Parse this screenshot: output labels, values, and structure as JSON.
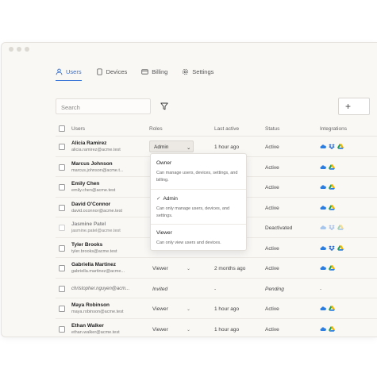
{
  "tabs": [
    {
      "label": "Users",
      "icon": "user-icon",
      "active": true
    },
    {
      "label": "Devices",
      "icon": "device-icon",
      "active": false
    },
    {
      "label": "Billing",
      "icon": "card-icon",
      "active": false
    },
    {
      "label": "Settings",
      "icon": "gear-icon",
      "active": false
    }
  ],
  "search": {
    "placeholder": "Search"
  },
  "add_button": {
    "label": "+"
  },
  "columns": {
    "users": "Users",
    "roles": "Roles",
    "last_active": "Last active",
    "status": "Status",
    "integrations": "Integrations"
  },
  "rows": [
    {
      "name": "Alicia Ramirez",
      "email": "alicia.ramirez@acme.test",
      "role": "Admin",
      "last_active": "1 hour ago",
      "status": "Active"
    },
    {
      "name": "Marcus Johnson",
      "email": "marcus.johnson@acme.t...",
      "role": "",
      "last_active": "",
      "status": "Active"
    },
    {
      "name": "Emily Chen",
      "email": "emily.chen@acme.test",
      "role": "",
      "last_active": "",
      "status": "Active"
    },
    {
      "name": "David O'Connor",
      "email": "david.oconnor@acme.test",
      "role": "",
      "last_active": "",
      "status": "Active"
    },
    {
      "name": "Jasmine Patel",
      "email": "jasmine.patel@acme.test",
      "role": "",
      "last_active": "",
      "status": "Deactivated"
    },
    {
      "name": "Tyler Brooks",
      "email": "tyler.brooks@acme.test",
      "role": "",
      "last_active": "",
      "status": "Active"
    },
    {
      "name": "Gabriella Martinez",
      "email": "gabriella.martinez@acme...",
      "role": "Viewer",
      "last_active": "2 months ago",
      "status": "Active"
    },
    {
      "name": "",
      "email": "christopher.nguyen@acm...",
      "role": "Invited",
      "last_active": "-",
      "status": "Pending",
      "integrations": "-"
    },
    {
      "name": "Maya Robinson",
      "email": "maya.robinson@acme.test",
      "role": "Viewer",
      "last_active": "1 hour ago",
      "status": "Active"
    },
    {
      "name": "Ethan Walker",
      "email": "ethan.walker@acme.test",
      "role": "Viewer",
      "last_active": "1 hour ago",
      "status": "Active"
    }
  ],
  "role_dropdown": {
    "options": [
      {
        "title": "Owner",
        "desc": "Can manage users, devices, settings, and billing."
      },
      {
        "title": "Admin",
        "desc": "Can only manage users, devices, and settings.",
        "checked": true
      },
      {
        "title": "Viewer",
        "desc": "Can only view users and devices."
      }
    ]
  },
  "colors": {
    "accent": "#2f6fd6",
    "cloud": "#2b7de0",
    "dropbox": "#1e64d6",
    "drive_green": "#1f9d55",
    "drive_yellow": "#f4b400"
  }
}
